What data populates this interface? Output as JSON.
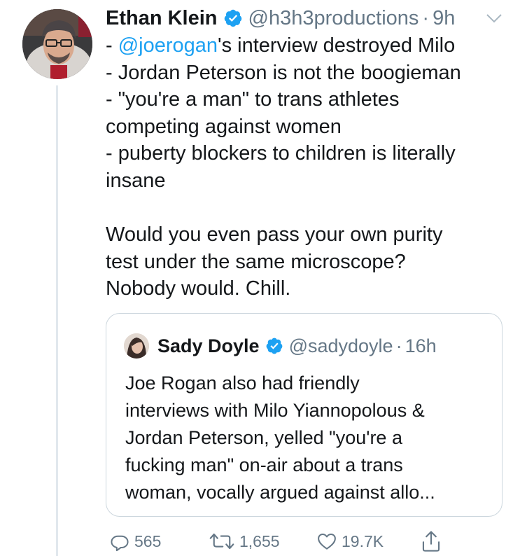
{
  "tweet": {
    "author_name": "Ethan Klein",
    "handle": "@h3h3productions",
    "separator": "·",
    "time": "9h",
    "body": {
      "line1_mention": "@joerogan",
      "line1_prefix": "- ",
      "line1_suffix": "'s interview destroyed Milo",
      "line2": "- Jordan Peterson is not the boogieman",
      "line3": "- \"you're a man\" to trans athletes",
      "line4": "competing against women",
      "line5": "- puberty blockers to children is literally",
      "line6": "insane",
      "line7": "Would you even pass your own purity",
      "line8": "test under the same microscope?",
      "line9": "Nobody would. Chill."
    }
  },
  "quote": {
    "author_name": "Sady Doyle",
    "handle": "@sadydoyle",
    "separator": "·",
    "time": "16h",
    "body": {
      "line1": "Joe Rogan also had friendly",
      "line2": "interviews with Milo Yiannopolous &",
      "line3": "Jordan Peterson, yelled \"you're a",
      "line4": "fucking man\" on-air about a trans",
      "line5": "woman, vocally argued against allo..."
    }
  },
  "actions": {
    "reply_count": "565",
    "retweet_count": "1,655",
    "like_count": "19.7K"
  },
  "colors": {
    "link": "#1da1f2",
    "secondary_text": "#657786",
    "verified_badge": "#1da1f2",
    "border": "#ccd6dd"
  },
  "icons": [
    "verified-badge-icon",
    "chevron-down-icon",
    "reply-icon",
    "retweet-icon",
    "like-icon",
    "share-icon"
  ]
}
